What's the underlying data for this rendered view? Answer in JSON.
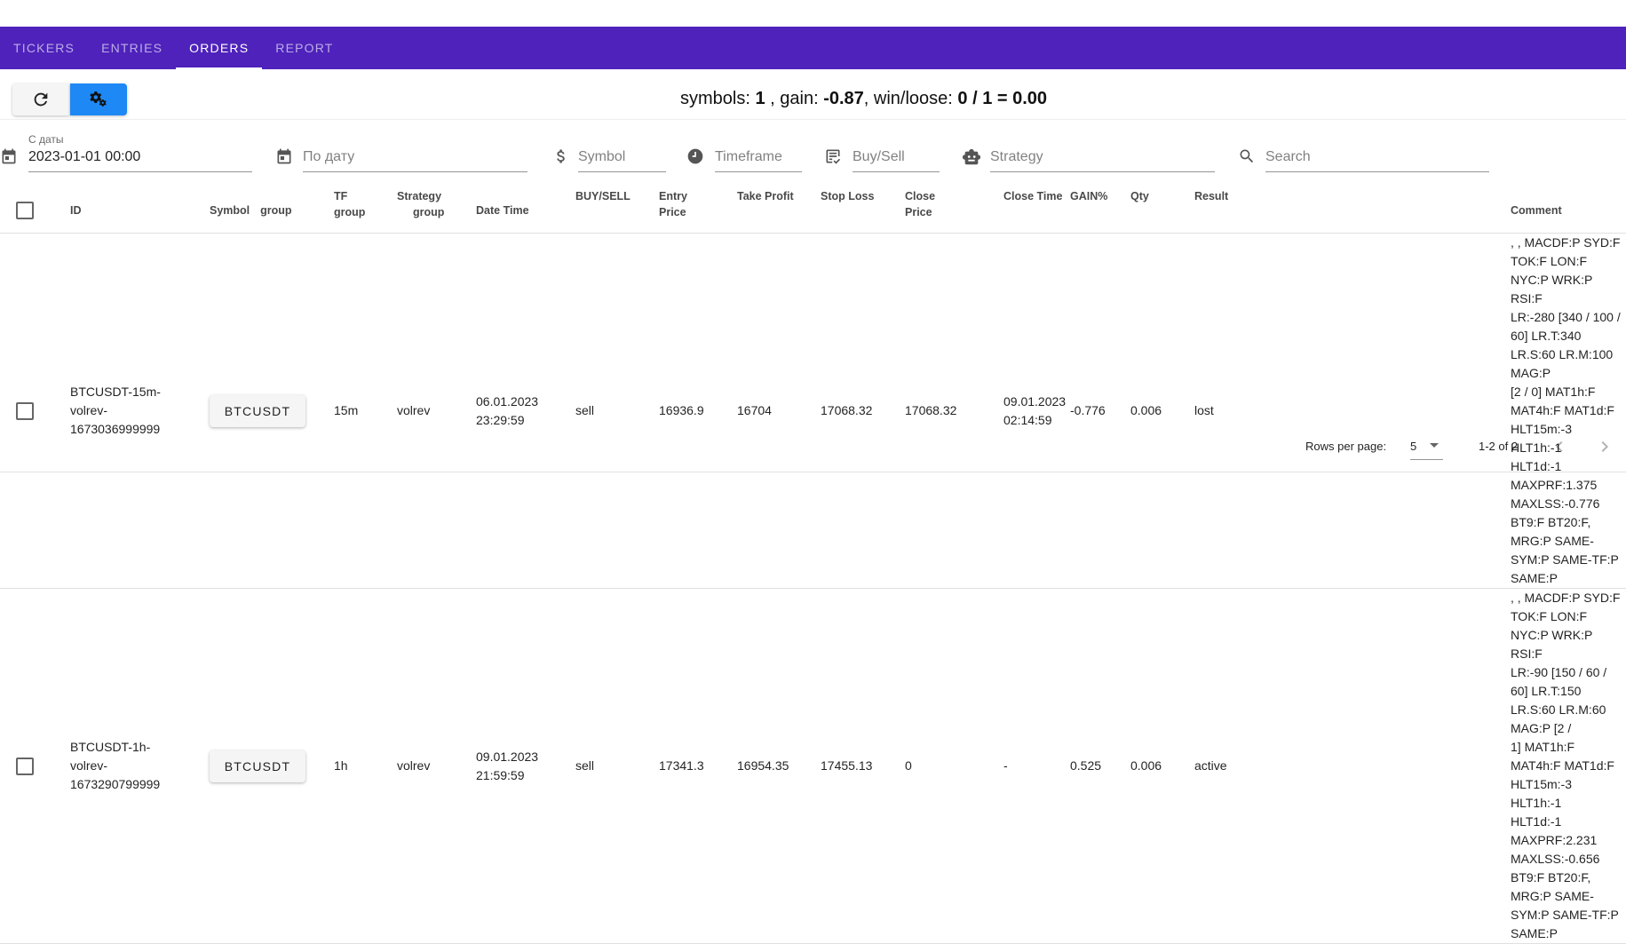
{
  "tabs": [
    {
      "label": "TICKERS",
      "active": false
    },
    {
      "label": "ENTRIES",
      "active": false
    },
    {
      "label": "ORDERS",
      "active": true
    },
    {
      "label": "REPORT",
      "active": false
    }
  ],
  "toolbar": {
    "refresh_icon": "refresh-icon",
    "settings_icon": "gears-icon",
    "settings_color": "#1e88f5"
  },
  "summary": {
    "symbols_label": "symbols: ",
    "symbols_value": "1",
    "gain_label": " , gain: ",
    "gain_value": "-0.87",
    "winloose_label": ", win/loose: ",
    "winloose_value": "0 / 1 = 0.00"
  },
  "filters": {
    "from_date": {
      "label": "С даты",
      "value": "2023-01-01 00:00",
      "icon": "calendar-icon"
    },
    "to_date": {
      "placeholder": "По дату",
      "icon": "calendar-icon"
    },
    "symbol": {
      "placeholder": "Symbol",
      "icon": "dollar-icon"
    },
    "timeframe": {
      "placeholder": "Timeframe",
      "icon": "clock-icon"
    },
    "buysell": {
      "placeholder": "Buy/Sell",
      "icon": "list-check-icon"
    },
    "strategy": {
      "placeholder": "Strategy",
      "icon": "robot-icon"
    },
    "search": {
      "placeholder": "Search",
      "icon": "search-icon"
    }
  },
  "table": {
    "headers": {
      "id": "ID",
      "symbol": "Symbol",
      "symbol_group": "group",
      "tf": "TF",
      "tf_group": "group",
      "strategy": "Strategy",
      "strategy_group": "group",
      "datetime": "Date Time",
      "buysell": "BUY/SELL",
      "entry1": "Entry",
      "entry2": "Price",
      "take_profit": "Take Profit",
      "stop_loss": "Stop Loss",
      "close1": "Close",
      "close2": "Price",
      "close_time": "Close Time",
      "gain": "GAIN%",
      "qty": "Qty",
      "result": "Result",
      "comment": "Comment"
    },
    "rows": [
      {
        "id_lines": [
          "BTCUSDT-15m-",
          "volrev-",
          "1673036999999"
        ],
        "symbol": "BTCUSDT",
        "tf": "15m",
        "strategy": "volrev",
        "datetime_lines": [
          "06.01.2023",
          "23:29:59"
        ],
        "buysell": "sell",
        "entry_price": "16936.9",
        "take_profit": "16704",
        "stop_loss": "17068.32",
        "close_price": "17068.32",
        "close_time_lines": [
          "09.01.2023",
          "02:14:59"
        ],
        "gain": "-0.776",
        "gain_color": "#e8112d",
        "qty": "0.006",
        "result": "lost",
        "comment_lines": [
          ", , MACDF:P SYD:F TOK:F LON:F NYC:P WRK:P RSI:F",
          "LR:-280 [340 / 100 / 60] LR.T:340 LR.S:60 LR.M:100 MAG:P",
          "[2 / 0] MAT1h:F MAT4h:F MAT1d:F HLT15m:-3 HLT1h:-1",
          "HLT1d:-1 MAXPRF:1.375 MAXLSS:-0.776 BT9:F BT20:F,",
          "MRG:P SAME-SYM:P SAME-TF:P SAME:P"
        ]
      },
      {
        "id_lines": [
          "BTCUSDT-1h-",
          "volrev-",
          "1673290799999"
        ],
        "symbol": "BTCUSDT",
        "tf": "1h",
        "strategy": "volrev",
        "datetime_lines": [
          "09.01.2023",
          "21:59:59"
        ],
        "buysell": "sell",
        "entry_price": "17341.3",
        "take_profit": "16954.35",
        "stop_loss": "17455.13",
        "close_price": "0",
        "close_time_lines": [
          "-"
        ],
        "gain": "0.525",
        "gain_color": "#1db33a",
        "qty": "0.006",
        "result": "active",
        "comment_lines": [
          ", , MACDF:P SYD:F TOK:F LON:F NYC:P WRK:P RSI:F",
          "LR:-90 [150 / 60 / 60] LR.T:150 LR.S:60 LR.M:60 MAG:P [2 /",
          "1] MAT1h:F MAT4h:F MAT1d:F HLT15m:-3 HLT1h:-1",
          "HLT1d:-1 MAXPRF:2.231 MAXLSS:-0.656 BT9:F BT20:F,",
          "MRG:P SAME-SYM:P SAME-TF:P SAME:P"
        ]
      }
    ]
  },
  "pagination": {
    "rows_per_page_label": "Rows per page:",
    "rows_per_page_value": "5",
    "range": "1-2 of 2",
    "prev_icon": "chevron-left-icon",
    "next_icon": "chevron-right-icon"
  }
}
